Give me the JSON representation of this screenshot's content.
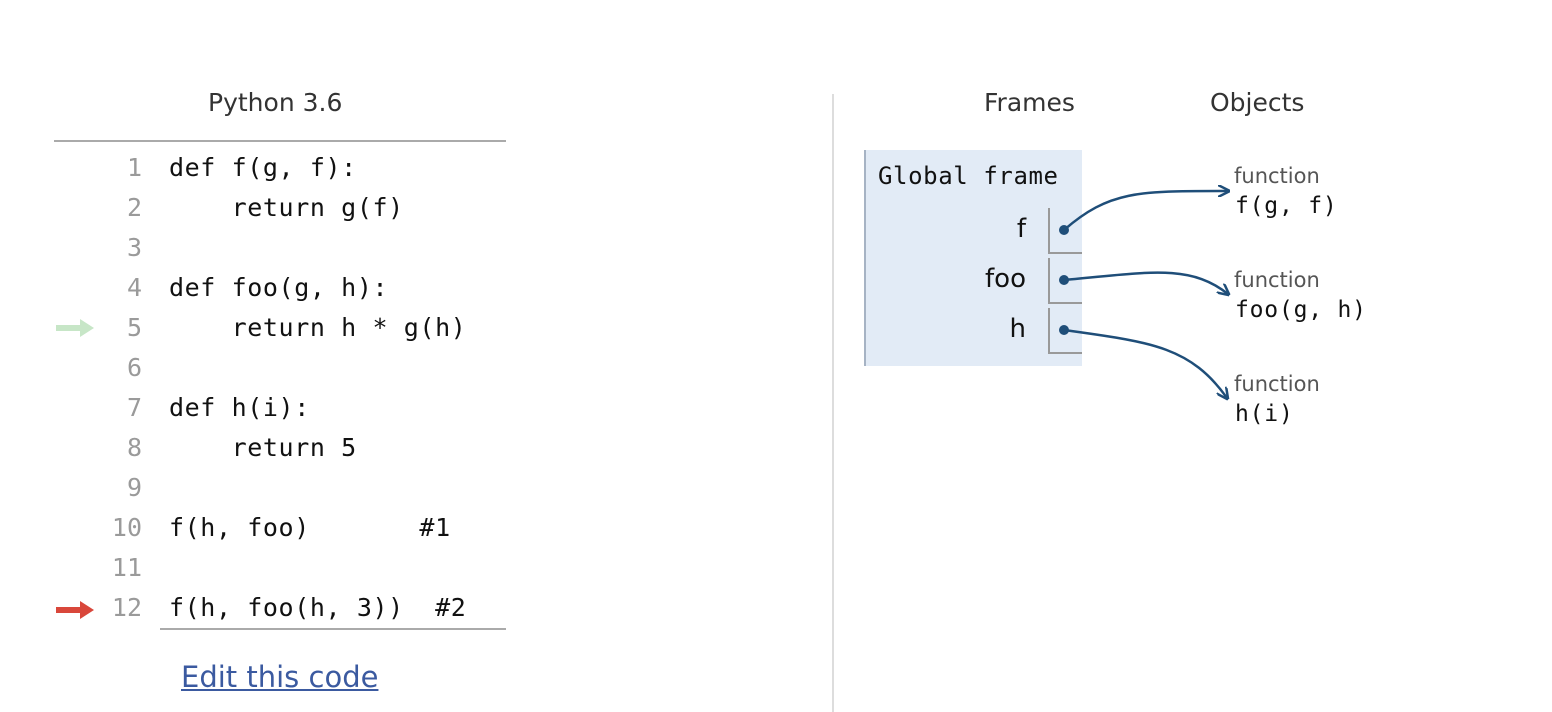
{
  "code_panel": {
    "language": "Python 3.6",
    "lines": [
      {
        "no": "1",
        "code": "def f(g, f):"
      },
      {
        "no": "2",
        "code": "    return g(f)"
      },
      {
        "no": "3",
        "code": ""
      },
      {
        "no": "4",
        "code": "def foo(g, h):"
      },
      {
        "no": "5",
        "code": "    return h * g(h)"
      },
      {
        "no": "6",
        "code": ""
      },
      {
        "no": "7",
        "code": "def h(i):"
      },
      {
        "no": "8",
        "code": "    return 5"
      },
      {
        "no": "9",
        "code": ""
      },
      {
        "no": "10",
        "code": "f(h, foo)       #1"
      },
      {
        "no": "11",
        "code": ""
      },
      {
        "no": "12",
        "code": "f(h, foo(h, 3))  #2"
      }
    ],
    "prev_line_arrow": {
      "line": "5",
      "color": "#c7e6c7"
    },
    "next_line_arrow": {
      "line": "12",
      "color": "#d9473b"
    },
    "edit_link": "Edit this code"
  },
  "viz_panel": {
    "frames_header": "Frames",
    "objects_header": "Objects",
    "global_frame": {
      "title": "Global frame",
      "variables": [
        {
          "name": "f"
        },
        {
          "name": "foo"
        },
        {
          "name": "h"
        }
      ]
    },
    "objects": [
      {
        "type": "function",
        "signature": "f(g, f)"
      },
      {
        "type": "function",
        "signature": "foo(g, h)"
      },
      {
        "type": "function",
        "signature": "h(i)"
      }
    ],
    "pointer_color": "#1f4e79",
    "frame_color": "#e2ebf6"
  }
}
